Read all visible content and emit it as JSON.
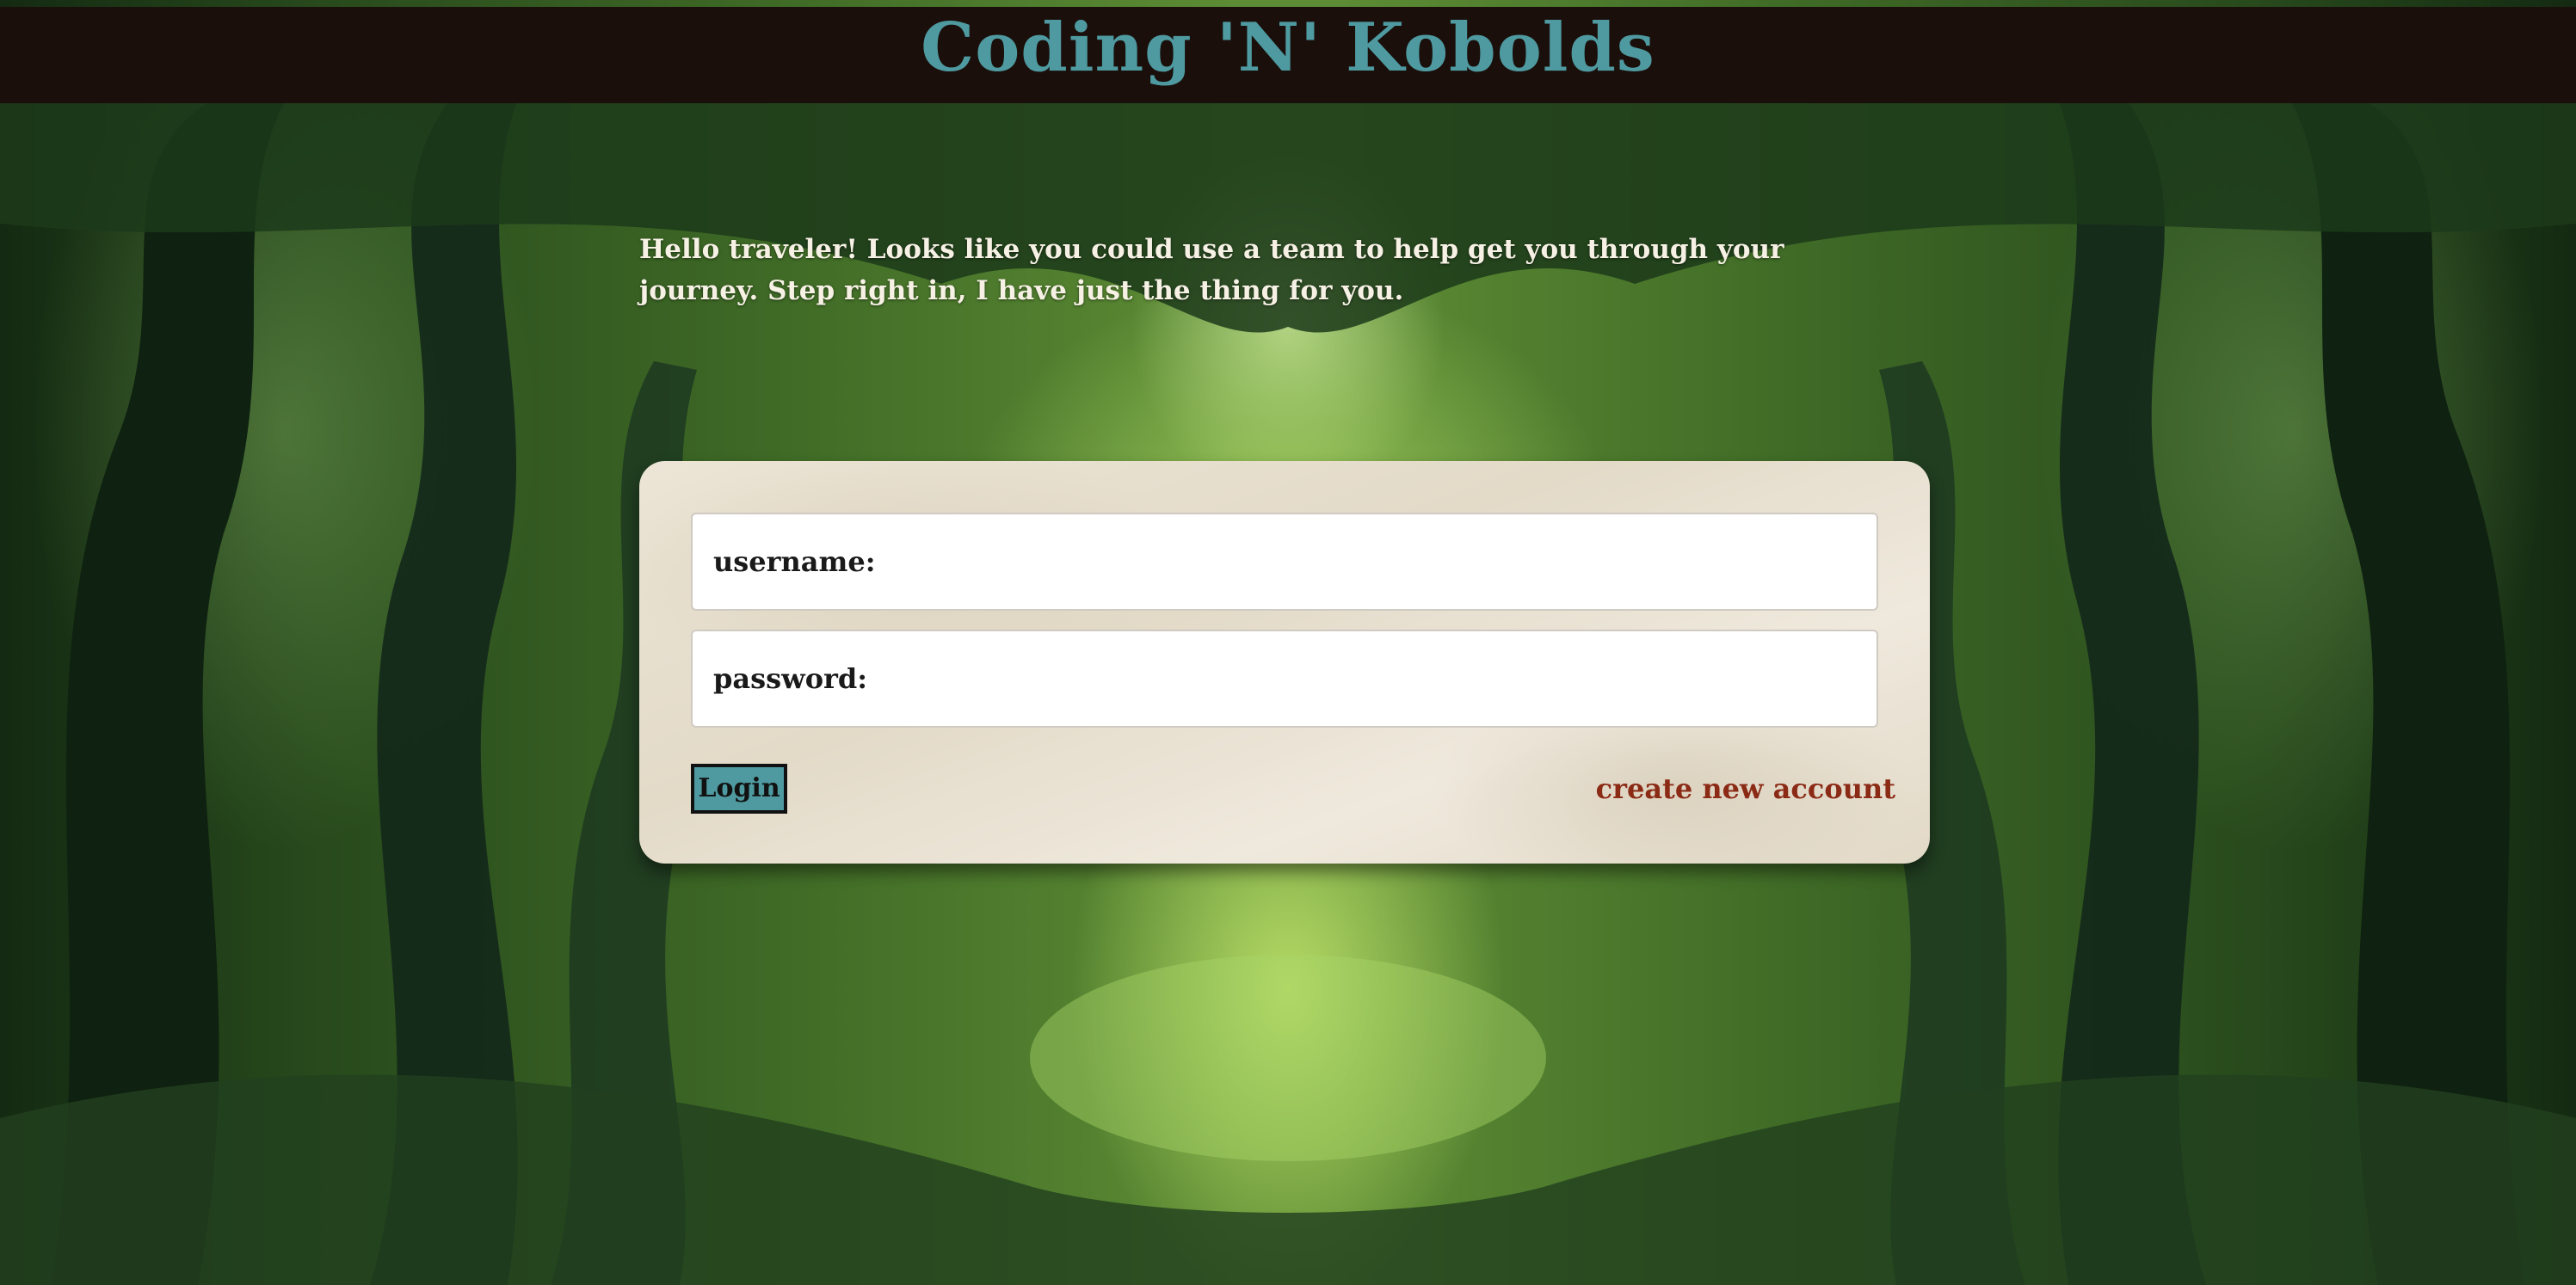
{
  "header": {
    "title": "Coding 'N' Kobolds"
  },
  "intro": {
    "text": "Hello traveler! Looks like you could use a team to help get you through your journey. Step right in, I have just the thing for you."
  },
  "login_form": {
    "username_label": "username:",
    "password_label": "password:",
    "login_button": "Login",
    "create_account_link": "create new account"
  },
  "colors": {
    "header_bg": "#1a0f0b",
    "title": "#4e9aa0",
    "button_bg": "#4e9aa0",
    "link": "#8b2a15"
  }
}
